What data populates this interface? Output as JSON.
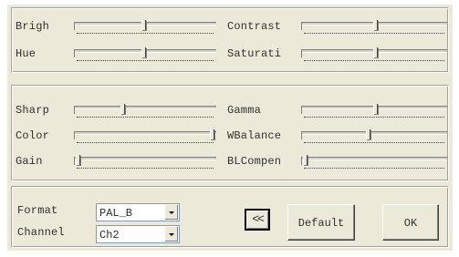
{
  "picture": {
    "brightness": {
      "label": "Brigh",
      "value": 0.49
    },
    "contrast": {
      "label": "Contrast",
      "value": 0.51
    },
    "hue": {
      "label": "Hue",
      "value": 0.49
    },
    "saturation": {
      "label": "Saturati",
      "value": 0.51
    }
  },
  "advanced": {
    "sharpness": {
      "label": "Sharp",
      "value": 0.34
    },
    "gamma": {
      "label": "Gamma",
      "value": 0.51
    },
    "color": {
      "label": "Color",
      "value": 0.99
    },
    "wbalance": {
      "label": "WBalance",
      "value": 0.46
    },
    "gain": {
      "label": "Gain",
      "value": 0.01
    },
    "blcompen": {
      "label": "BLCompen",
      "value": 0.01
    }
  },
  "video": {
    "format_label": "Format",
    "format_value": "PAL_B",
    "channel_label": "Channel",
    "channel_value": "Ch2"
  },
  "buttons": {
    "collapse": "<<",
    "default": "Default",
    "ok": "OK"
  }
}
